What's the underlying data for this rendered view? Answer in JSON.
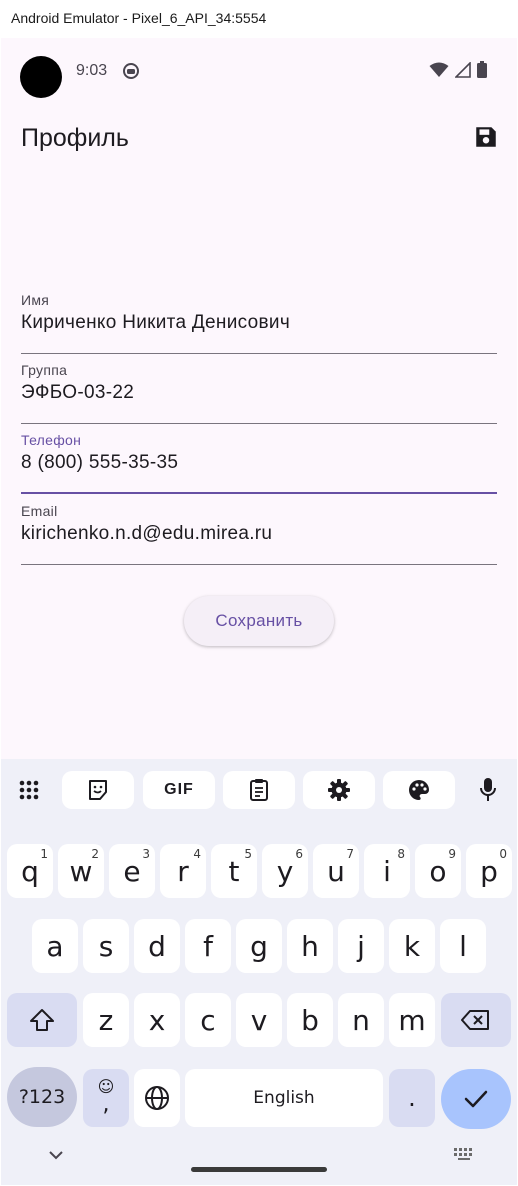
{
  "window": {
    "title": "Android Emulator - Pixel_6_API_34:5554"
  },
  "status_bar": {
    "time": "9:03"
  },
  "app": {
    "title": "Профиль"
  },
  "form": {
    "fields": [
      {
        "label": "Имя",
        "value": "Кириченко Никита Денисович",
        "focused": false
      },
      {
        "label": "Группа",
        "value": "ЭФБО-03-22",
        "focused": false
      },
      {
        "label": "Телефон",
        "value": "8 (800) 555-35-35",
        "focused": true
      },
      {
        "label": "Email",
        "value": "kirichenko.n.d@edu.mirea.ru",
        "focused": false
      }
    ],
    "save_button": "Сохранить"
  },
  "keyboard": {
    "row1": [
      {
        "char": "q",
        "hint": "1"
      },
      {
        "char": "w",
        "hint": "2"
      },
      {
        "char": "e",
        "hint": "3"
      },
      {
        "char": "r",
        "hint": "4"
      },
      {
        "char": "t",
        "hint": "5"
      },
      {
        "char": "y",
        "hint": "6"
      },
      {
        "char": "u",
        "hint": "7"
      },
      {
        "char": "i",
        "hint": "8"
      },
      {
        "char": "o",
        "hint": "9"
      },
      {
        "char": "p",
        "hint": "0"
      }
    ],
    "row2": [
      "a",
      "s",
      "d",
      "f",
      "g",
      "h",
      "j",
      "k",
      "l"
    ],
    "row3": [
      "z",
      "x",
      "c",
      "v",
      "b",
      "n",
      "m"
    ],
    "sym_key": "?123",
    "comma_key": ",",
    "emoji_hint": "☺",
    "space_label": "English",
    "period_key": ".",
    "gif_label": "GIF",
    "colors": {
      "background": "#eff0f8",
      "key": "#ffffff",
      "modifier": "#d9dcf2",
      "action": "#a8c4fd",
      "accent": "#6750a4"
    }
  }
}
